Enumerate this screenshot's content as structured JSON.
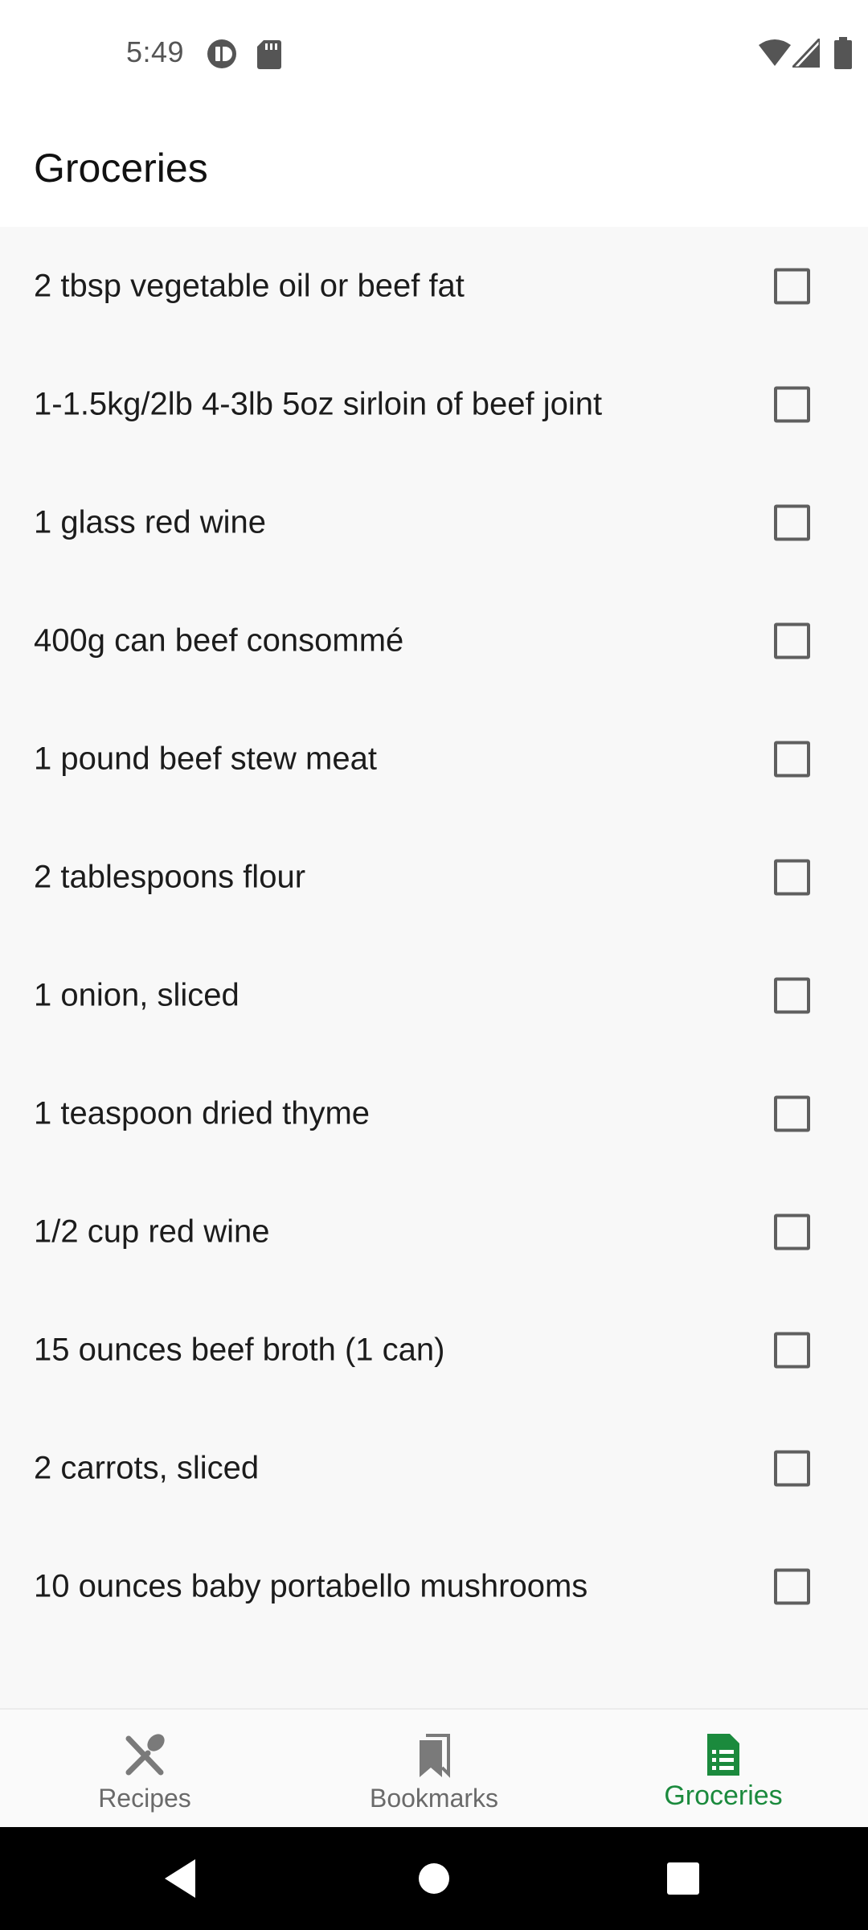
{
  "status_bar": {
    "time": "5:49",
    "icons": [
      "privacy-indicator-icon",
      "sd-card-icon",
      "wifi-icon",
      "cellular-signal-icon",
      "battery-icon"
    ]
  },
  "app_bar": {
    "title": "Groceries"
  },
  "groceries": [
    {
      "label": "2 tbsp vegetable oil or beef fat",
      "checked": false
    },
    {
      "label": "1-1.5kg/2lb 4-3lb 5oz sirloin of beef joint",
      "checked": false
    },
    {
      "label": "1 glass red wine",
      "checked": false
    },
    {
      "label": "400g can beef consommé",
      "checked": false
    },
    {
      "label": "1 pound beef stew meat",
      "checked": false
    },
    {
      "label": "2 tablespoons flour",
      "checked": false
    },
    {
      "label": "1 onion, sliced",
      "checked": false
    },
    {
      "label": "1 teaspoon dried thyme",
      "checked": false
    },
    {
      "label": "1/2 cup red wine",
      "checked": false
    },
    {
      "label": "15 ounces beef broth (1 can)",
      "checked": false
    },
    {
      "label": "2 carrots, sliced",
      "checked": false
    },
    {
      "label": "10 ounces baby portabello mushrooms",
      "checked": false
    }
  ],
  "bottom_nav": {
    "items": [
      {
        "label": "Recipes",
        "icon": "fork-knife-icon",
        "active": false
      },
      {
        "label": "Bookmarks",
        "icon": "bookmarks-icon",
        "active": false
      },
      {
        "label": "Groceries",
        "icon": "grocery-list-icon",
        "active": true
      }
    ]
  },
  "colors": {
    "accent": "#1b8a3d",
    "inactive": "#6a6a6a",
    "background": "#f8f8f8"
  }
}
